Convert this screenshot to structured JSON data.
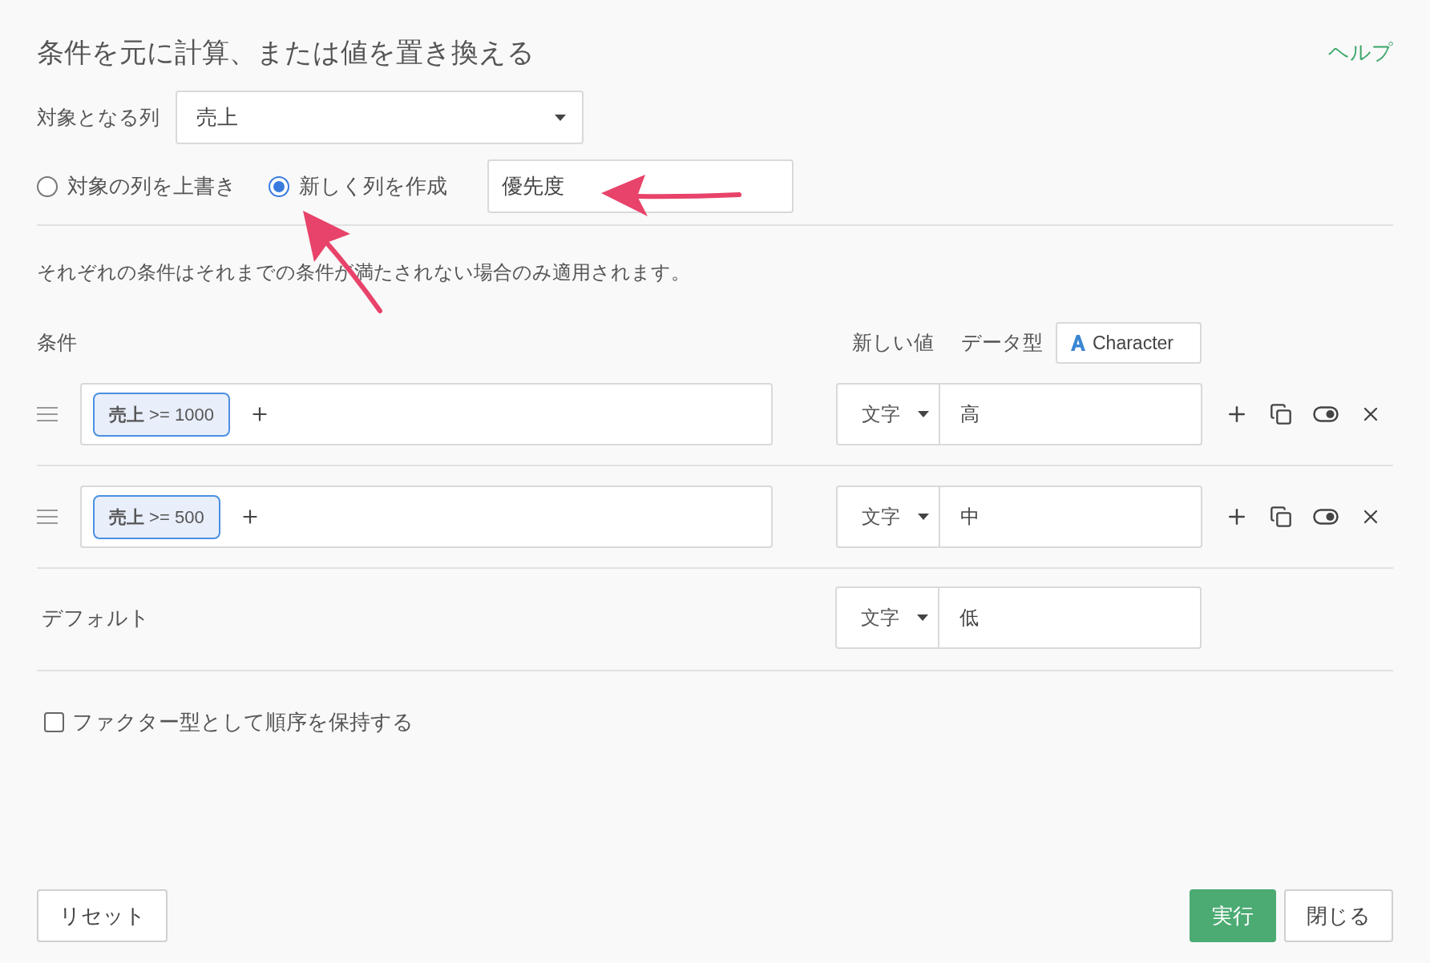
{
  "dialog": {
    "title": "条件を元に計算、または値を置き換える",
    "help_link": "ヘルプ"
  },
  "target_column": {
    "label": "対象となる列",
    "value": "売上"
  },
  "output_options": [
    {
      "label": "対象の列を上書き",
      "selected": false
    },
    {
      "label": "新しく列を作成",
      "selected": true
    }
  ],
  "new_column_name": {
    "value": "優先度"
  },
  "notice": "それぞれの条件はそれまでの条件が満たされない場合のみ適用されます。",
  "conditions_header": {
    "label": "条件",
    "new_value_label": "新しい値",
    "data_type_label": "データ型",
    "data_type": "Character"
  },
  "conditions": [
    {
      "chip": "**売上** >= 1000",
      "value_type": "文字",
      "value": "高"
    },
    {
      "chip": "**売上** >= 500",
      "value_type": "文字",
      "value": "中"
    }
  ],
  "default": {
    "label": "デフォルト",
    "value_type": "文字",
    "value": "低"
  },
  "factor_option": {
    "label": "ファクター型として順序を保持する",
    "checked": false
  },
  "buttons": {
    "reset": "リセット",
    "run": "実行",
    "close": "閉じる"
  }
}
